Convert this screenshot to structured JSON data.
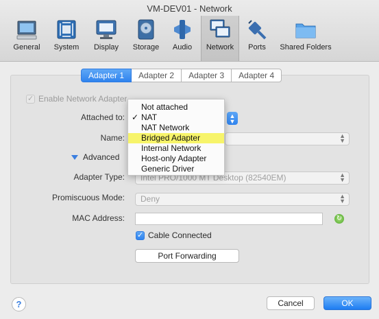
{
  "window": {
    "title": "VM-DEV01 - Network"
  },
  "toolbar": {
    "items": [
      {
        "label": "General",
        "icon": "general-icon"
      },
      {
        "label": "System",
        "icon": "system-chip-icon"
      },
      {
        "label": "Display",
        "icon": "display-monitor-icon"
      },
      {
        "label": "Storage",
        "icon": "storage-disk-icon"
      },
      {
        "label": "Audio",
        "icon": "audio-speaker-icon"
      },
      {
        "label": "Network",
        "icon": "network-icon",
        "active": true
      },
      {
        "label": "Ports",
        "icon": "ports-plug-icon"
      },
      {
        "label": "Shared Folders",
        "icon": "shared-folder-icon"
      }
    ]
  },
  "tabs": [
    "Adapter 1",
    "Adapter 2",
    "Adapter 3",
    "Adapter 4"
  ],
  "form": {
    "enable_adapter": "Enable Network Adapter",
    "attached_to_label": "Attached to:",
    "name_label": "Name:",
    "advanced_label": "Advanced",
    "adapter_type_label": "Adapter Type:",
    "adapter_type_value": "Intel PRO/1000 MT Desktop (82540EM)",
    "promiscuous_label": "Promiscuous Mode:",
    "promiscuous_value": "Deny",
    "mac_label": "MAC Address:",
    "mac_value": "",
    "cable_connected": "Cable Connected",
    "port_forwarding": "Port Forwarding"
  },
  "dropdown": {
    "items": [
      "Not attached",
      "NAT",
      "NAT Network",
      "Bridged Adapter",
      "Internal Network",
      "Host-only Adapter",
      "Generic Driver"
    ],
    "checked": "NAT",
    "highlighted": "Bridged Adapter",
    "checkmark": "✓"
  },
  "footer": {
    "help": "?",
    "cancel": "Cancel",
    "ok": "OK"
  },
  "colors": {
    "accent": "#2f83ee",
    "highlight": "#f7f46a"
  }
}
